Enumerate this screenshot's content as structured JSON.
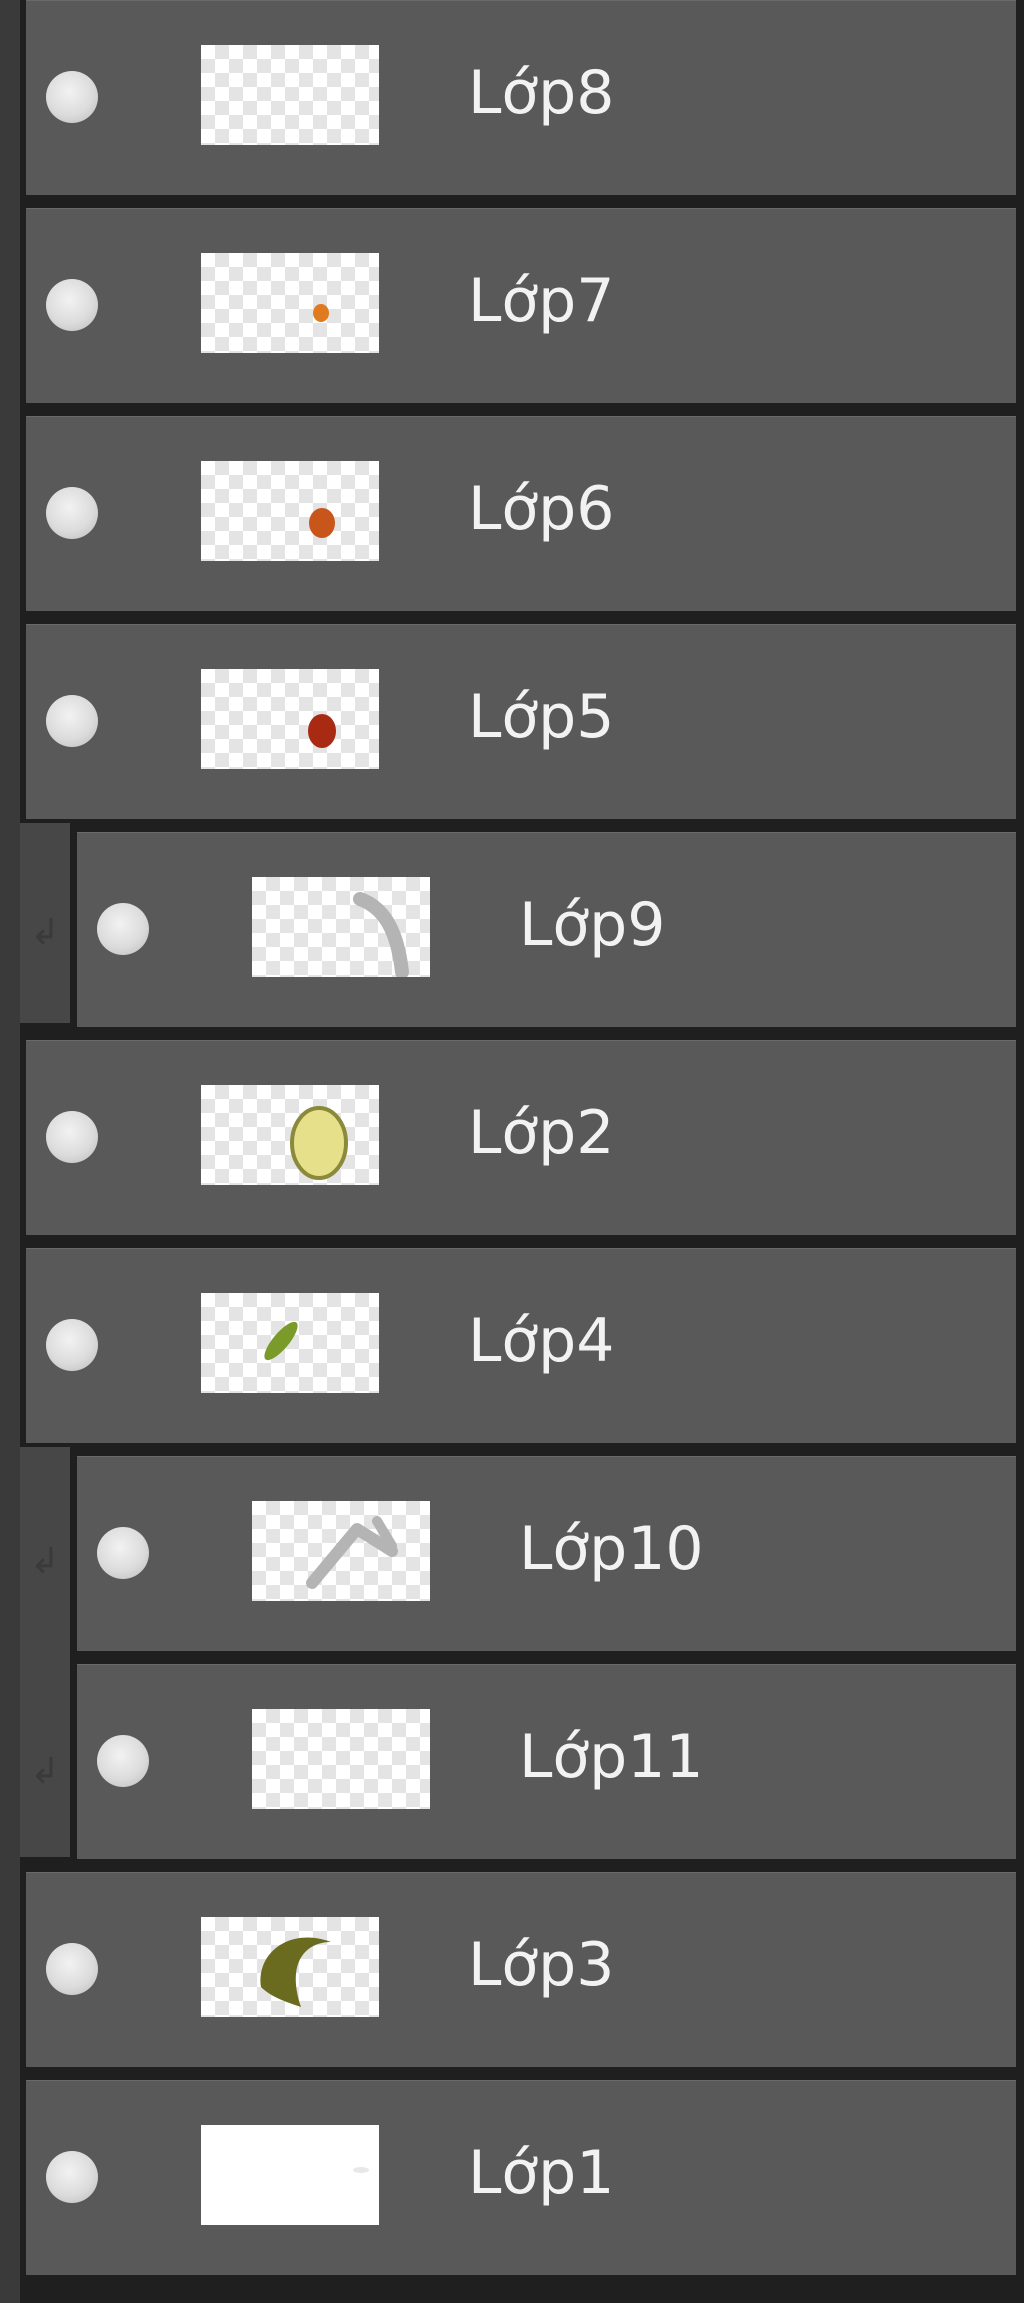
{
  "panel": {
    "title": "",
    "layers": [
      {
        "name": "Lớp8",
        "clipped": false,
        "visible": true,
        "thumb_icon": "empty-transparent-thumbnail"
      },
      {
        "name": "Lớp7",
        "clipped": false,
        "visible": true,
        "thumb_icon": "small-orange-dot-thumbnail"
      },
      {
        "name": "Lớp6",
        "clipped": false,
        "visible": true,
        "thumb_icon": "orange-dot-thumbnail"
      },
      {
        "name": "Lớp5",
        "clipped": false,
        "visible": true,
        "thumb_icon": "dark-red-dot-thumbnail"
      },
      {
        "name": "Lớp9",
        "clipped": true,
        "visible": true,
        "thumb_icon": "gray-curve-thumbnail"
      },
      {
        "name": "Lớp2",
        "clipped": false,
        "visible": true,
        "thumb_icon": "yellow-oval-thumbnail"
      },
      {
        "name": "Lớp4",
        "clipped": false,
        "visible": true,
        "thumb_icon": "green-leaf-thumbnail"
      },
      {
        "name": "Lớp10",
        "clipped": true,
        "visible": true,
        "thumb_icon": "gray-strokes-thumbnail"
      },
      {
        "name": "Lớp11",
        "clipped": true,
        "visible": true,
        "thumb_icon": "empty-transparent-thumbnail"
      },
      {
        "name": "Lớp3",
        "clipped": false,
        "visible": true,
        "thumb_icon": "olive-crescent-thumbnail"
      },
      {
        "name": "Lớp1",
        "clipped": false,
        "visible": true,
        "thumb_icon": "white-background-thumbnail"
      }
    ]
  },
  "colors": {
    "row_bg": "#595959",
    "panel_bg": "#1f1f1f",
    "text": "#f2f2f2",
    "dot_orange": "#e07a1f",
    "dot_orange_dark": "#c8561a",
    "dot_red": "#a82a12",
    "oval_yellow": "#e6e08a",
    "leaf_green": "#7a9a2a",
    "crescent_olive": "#6b6b1f",
    "stroke_gray": "#b4b4b4"
  }
}
